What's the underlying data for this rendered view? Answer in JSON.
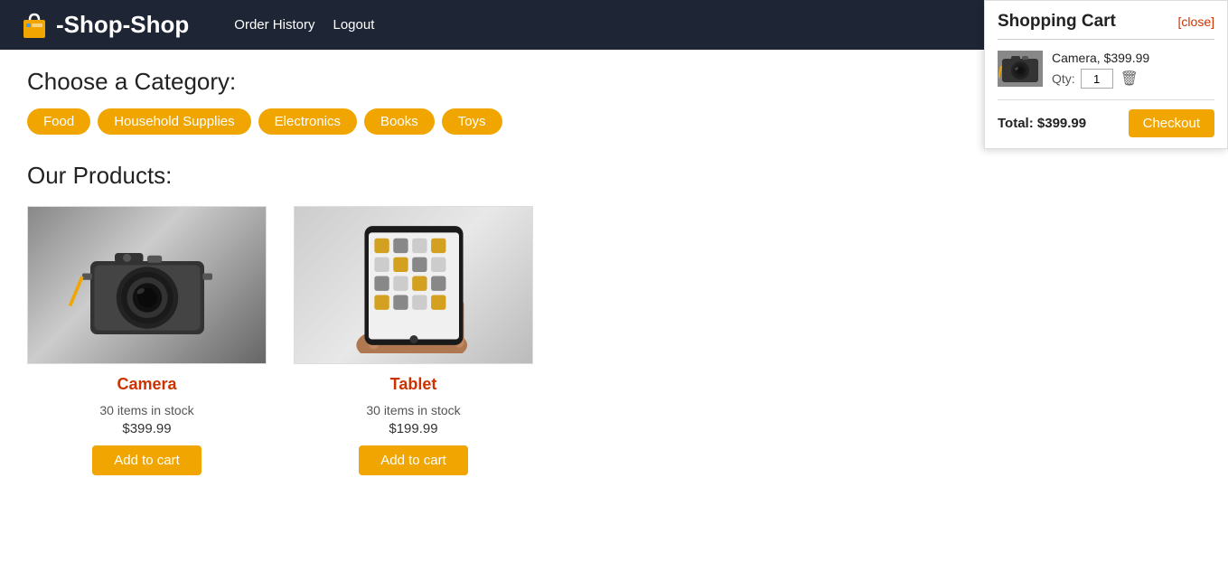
{
  "header": {
    "logo_text": "-Shop-Shop",
    "nav": [
      {
        "label": "Order History",
        "id": "order-history"
      },
      {
        "label": "Logout",
        "id": "logout"
      }
    ]
  },
  "main": {
    "choose_category_label": "Choose a Category:",
    "categories": [
      {
        "label": "Food",
        "id": "food"
      },
      {
        "label": "Household Supplies",
        "id": "household-supplies"
      },
      {
        "label": "Electronics",
        "id": "electronics"
      },
      {
        "label": "Books",
        "id": "books"
      },
      {
        "label": "Toys",
        "id": "toys"
      }
    ],
    "products_label": "Our Products:",
    "products": [
      {
        "id": "camera",
        "name": "Camera",
        "stock": "30 items in stock",
        "price": "$399.99",
        "add_to_cart_label": "Add to cart",
        "type": "camera"
      },
      {
        "id": "tablet",
        "name": "Tablet",
        "stock": "30 items in stock",
        "price": "$199.99",
        "add_to_cart_label": "Add to cart",
        "type": "tablet"
      }
    ]
  },
  "cart": {
    "title": "Shopping Cart",
    "close_label": "[close]",
    "items": [
      {
        "id": "camera-cart-item",
        "name": "Camera, $399.99",
        "qty": 1,
        "qty_label": "Qty:"
      }
    ],
    "total_label": "Total: $399.99",
    "checkout_label": "Checkout"
  }
}
